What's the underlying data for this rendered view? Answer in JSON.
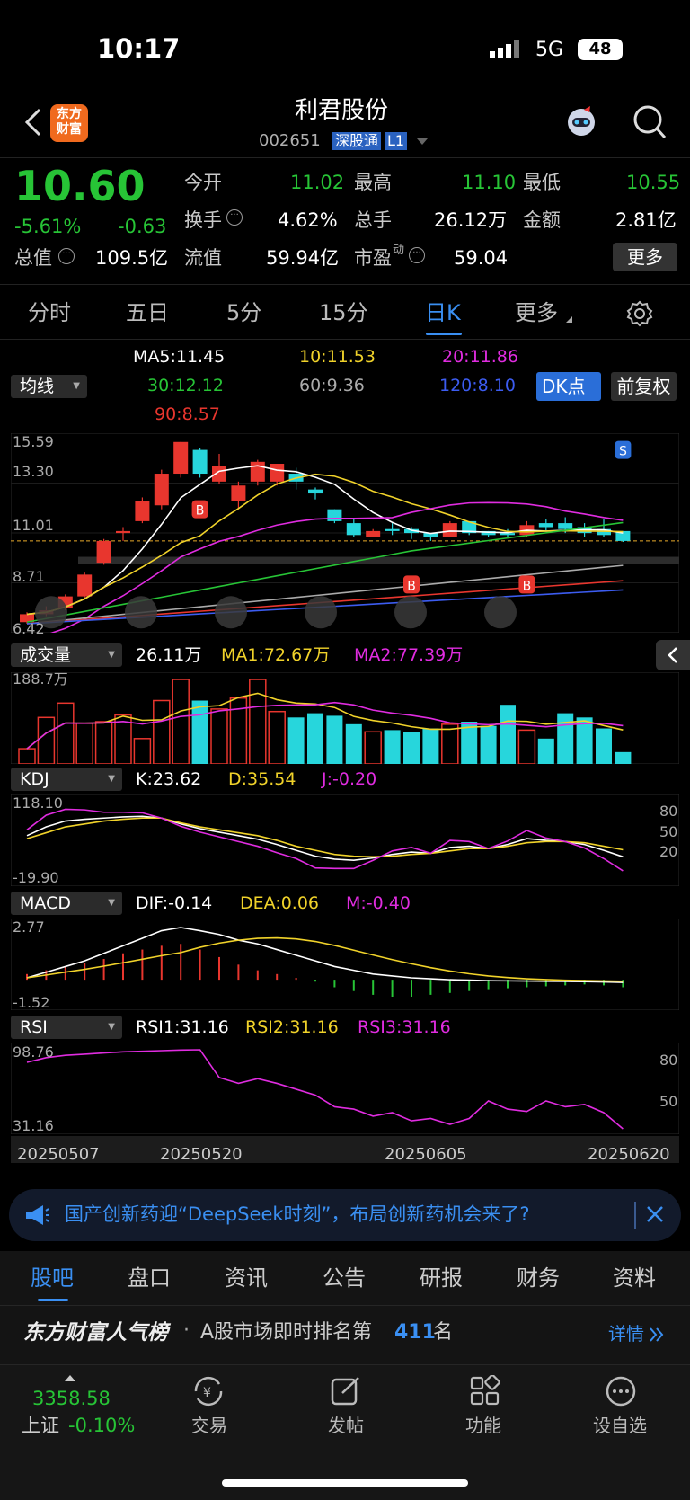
{
  "status": {
    "time": "10:17",
    "network": "5G",
    "battery": "48"
  },
  "header": {
    "title": "利君股份",
    "code": "002651",
    "tag": "深股通",
    "level": "L1",
    "app_logo": "东方财富"
  },
  "quote": {
    "price": "10.60",
    "change_pct": "-5.61%",
    "change": "-0.63",
    "open_label": "今开",
    "open": "11.02",
    "high_label": "最高",
    "high": "11.10",
    "low_label": "最低",
    "low": "10.55",
    "turnover_label": "换手",
    "turnover": "4.62%",
    "volume_label": "总手",
    "volume": "26.12万",
    "amount_label": "金额",
    "amount": "2.81亿",
    "mktcap_label": "总值",
    "mktcap": "109.5亿",
    "float_label": "流值",
    "float_cap": "59.94亿",
    "pe_label": "市盈",
    "pe_sup": "动",
    "pe": "59.04",
    "more": "更多"
  },
  "tabs": [
    "分时",
    "五日",
    "5分",
    "15分",
    "日K",
    "更多"
  ],
  "ma": {
    "selector": "均线",
    "ma5": "MA5:11.45",
    "ma10": "10:11.53",
    "ma20": "20:11.86",
    "ma30": "30:12.12",
    "ma60": "60:9.36",
    "ma120": "120:8.10",
    "ma90": "90:8.57",
    "dk": "DK点",
    "adjust": "前复权"
  },
  "kline": {
    "y_labels": [
      "15.59",
      "13.30",
      "11.01",
      "8.71",
      "6.42"
    ]
  },
  "vol": {
    "selector": "成交量",
    "value": "26.11万",
    "ma1": "MA1:72.67万",
    "ma2": "MA2:77.39万",
    "ymax": "188.7万"
  },
  "kdj": {
    "selector": "KDJ",
    "k": "K:23.62",
    "d": "D:35.54",
    "j": "J:-0.20",
    "ymax": "118.10",
    "ymin": "-19.90",
    "levels": [
      "80",
      "50",
      "20"
    ]
  },
  "macd": {
    "selector": "MACD",
    "dif": "DIF:-0.14",
    "dea": "DEA:0.06",
    "m": "M:-0.40",
    "ymax": "2.77",
    "ymin": "-1.52"
  },
  "rsi": {
    "selector": "RSI",
    "r1": "RSI1:31.16",
    "r2": "RSI2:31.16",
    "r3": "RSI3:31.16",
    "ymax": "98.76",
    "ymin": "31.16",
    "levels": [
      "80",
      "50"
    ]
  },
  "dates": [
    "20250507",
    "20250520",
    "20250605",
    "20250620"
  ],
  "news": {
    "text": "国产创新药迎“DeepSeek时刻”，布局创新药机会来了?"
  },
  "subtabs": [
    "股吧",
    "盘口",
    "资讯",
    "公告",
    "研报",
    "财务",
    "资料"
  ],
  "rank": {
    "brand": "东方财富人气榜",
    "text": "A股市场即时排名第",
    "num": "411",
    "suffix": "名",
    "detail": "详情"
  },
  "bottom": {
    "index_value": "3358.58",
    "index_name": "上证",
    "index_change": "-0.10%",
    "items": [
      "交易",
      "发帖",
      "功能",
      "设自选"
    ]
  },
  "chart_data": {
    "type": "candlestick",
    "title": "利君股份 日K",
    "ylim": [
      6.42,
      15.59
    ],
    "dates_shown": [
      "20250507",
      "20250520",
      "20250605",
      "20250620"
    ],
    "candles": [
      [
        6.5,
        6.9,
        6.42,
        7.0
      ],
      [
        6.9,
        7.1,
        6.8,
        7.3
      ],
      [
        7.2,
        7.8,
        7.1,
        7.9
      ],
      [
        7.8,
        8.9,
        7.7,
        9.0
      ],
      [
        9.5,
        10.6,
        9.4,
        10.7
      ],
      [
        11.0,
        11.1,
        10.6,
        11.3
      ],
      [
        11.6,
        12.6,
        11.5,
        12.8
      ],
      [
        12.4,
        14.0,
        12.2,
        14.2
      ],
      [
        14.0,
        15.6,
        13.8,
        15.6
      ],
      [
        15.2,
        14.0,
        13.8,
        15.3
      ],
      [
        13.6,
        14.4,
        13.5,
        15.0
      ],
      [
        12.6,
        13.4,
        12.2,
        13.6
      ],
      [
        13.6,
        14.6,
        13.4,
        14.7
      ],
      [
        13.6,
        14.5,
        13.4,
        14.5
      ],
      [
        14.0,
        13.6,
        13.2,
        14.3
      ],
      [
        13.2,
        13.0,
        12.7,
        13.3
      ],
      [
        12.2,
        11.6,
        11.5,
        12.2
      ],
      [
        11.5,
        10.9,
        10.8,
        11.7
      ],
      [
        10.8,
        11.1,
        10.8,
        11.2
      ],
      [
        11.2,
        11.1,
        10.9,
        11.5
      ],
      [
        11.2,
        11.0,
        10.7,
        11.3
      ],
      [
        11.0,
        10.8,
        10.6,
        11.0
      ],
      [
        10.8,
        11.5,
        10.8,
        11.6
      ],
      [
        11.6,
        11.0,
        10.9,
        11.6
      ],
      [
        11.1,
        10.9,
        10.8,
        11.1
      ],
      [
        11.0,
        10.9,
        10.8,
        11.2
      ],
      [
        10.9,
        11.4,
        10.8,
        11.6
      ],
      [
        11.5,
        11.3,
        11.1,
        11.7
      ],
      [
        11.5,
        11.2,
        11.0,
        11.8
      ],
      [
        11.3,
        11.0,
        10.8,
        11.5
      ],
      [
        11.2,
        10.9,
        10.8,
        11.7
      ],
      [
        11.1,
        10.6,
        10.55,
        11.1
      ]
    ],
    "volume_ratio": [
      0.18,
      0.55,
      0.72,
      0.48,
      0.5,
      0.58,
      0.3,
      0.75,
      1.0,
      0.75,
      0.65,
      0.78,
      1.0,
      0.62,
      0.55,
      0.6,
      0.57,
      0.47,
      0.38,
      0.4,
      0.38,
      0.42,
      0.47,
      0.5,
      0.45,
      0.7,
      0.4,
      0.3,
      0.6,
      0.55,
      0.42,
      0.14
    ]
  }
}
